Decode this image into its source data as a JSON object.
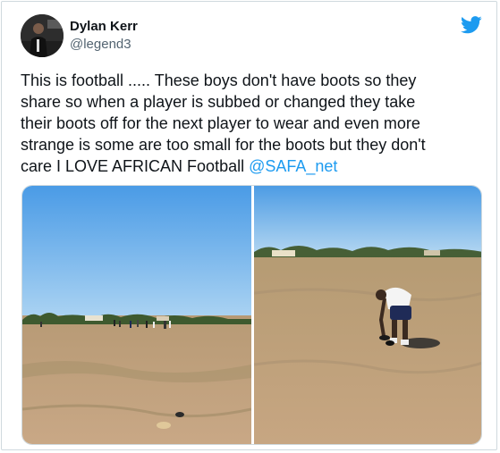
{
  "author": {
    "name": "Dylan Kerr",
    "handle": "@legend3"
  },
  "tweet": {
    "text_line1": "This is football ..... These boys don't have boots so they",
    "text_line2": "share so when a player is subbed or changed they take",
    "text_line3": "their boots off for the next player to wear and even more",
    "text_line4": "strange is some are too small for the boots but they don't",
    "text_line5": "care I LOVE AFRICAN Football ",
    "mention": "@SAFA_net"
  },
  "icons": {
    "brand": "twitter-bird-icon"
  },
  "colors": {
    "accent": "#1d9bf0",
    "text": "#0f1419",
    "secondary": "#536471",
    "border": "#cfd9de"
  }
}
